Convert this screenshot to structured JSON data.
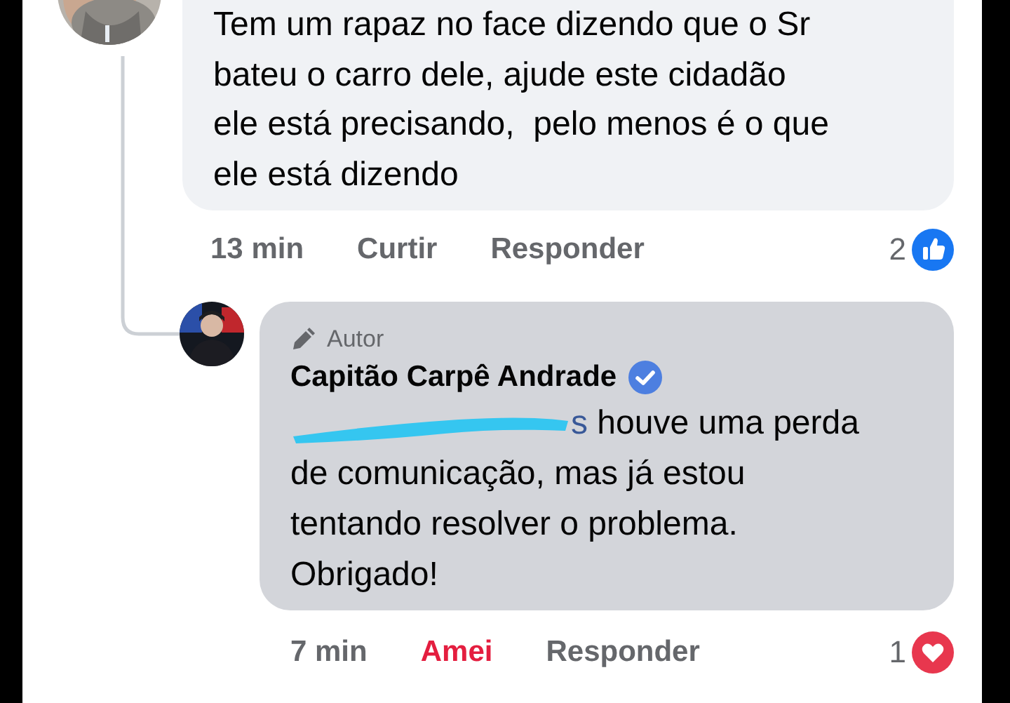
{
  "comments": [
    {
      "kind": "comment",
      "lines": [
        "Tem um rapaz no face dizendo que o Sr",
        "bateu o carro dele, ajude este cidadão",
        "ele está precisando,  pelo menos é o que",
        "ele está dizendo"
      ],
      "time": "13 min",
      "actions": [
        {
          "label": "Curtir",
          "selected": false
        },
        {
          "label": "Responder",
          "selected": false
        }
      ],
      "reaction": {
        "kind": "like",
        "count": "2"
      }
    },
    {
      "kind": "reply",
      "badge": "Autor",
      "author": "Capitão Carpê Andrade",
      "verified": true,
      "redacted": true,
      "mention": "s",
      "lines": [
        "houve uma perda",
        "de comunicação, mas já estou",
        "tentando resolver o problema.",
        "Obrigado!"
      ],
      "time": "7 min",
      "actions": [
        {
          "label": "Amei",
          "selected": true
        },
        {
          "label": "Responder",
          "selected": false
        }
      ],
      "reaction": {
        "kind": "love",
        "count": "1"
      }
    }
  ]
}
